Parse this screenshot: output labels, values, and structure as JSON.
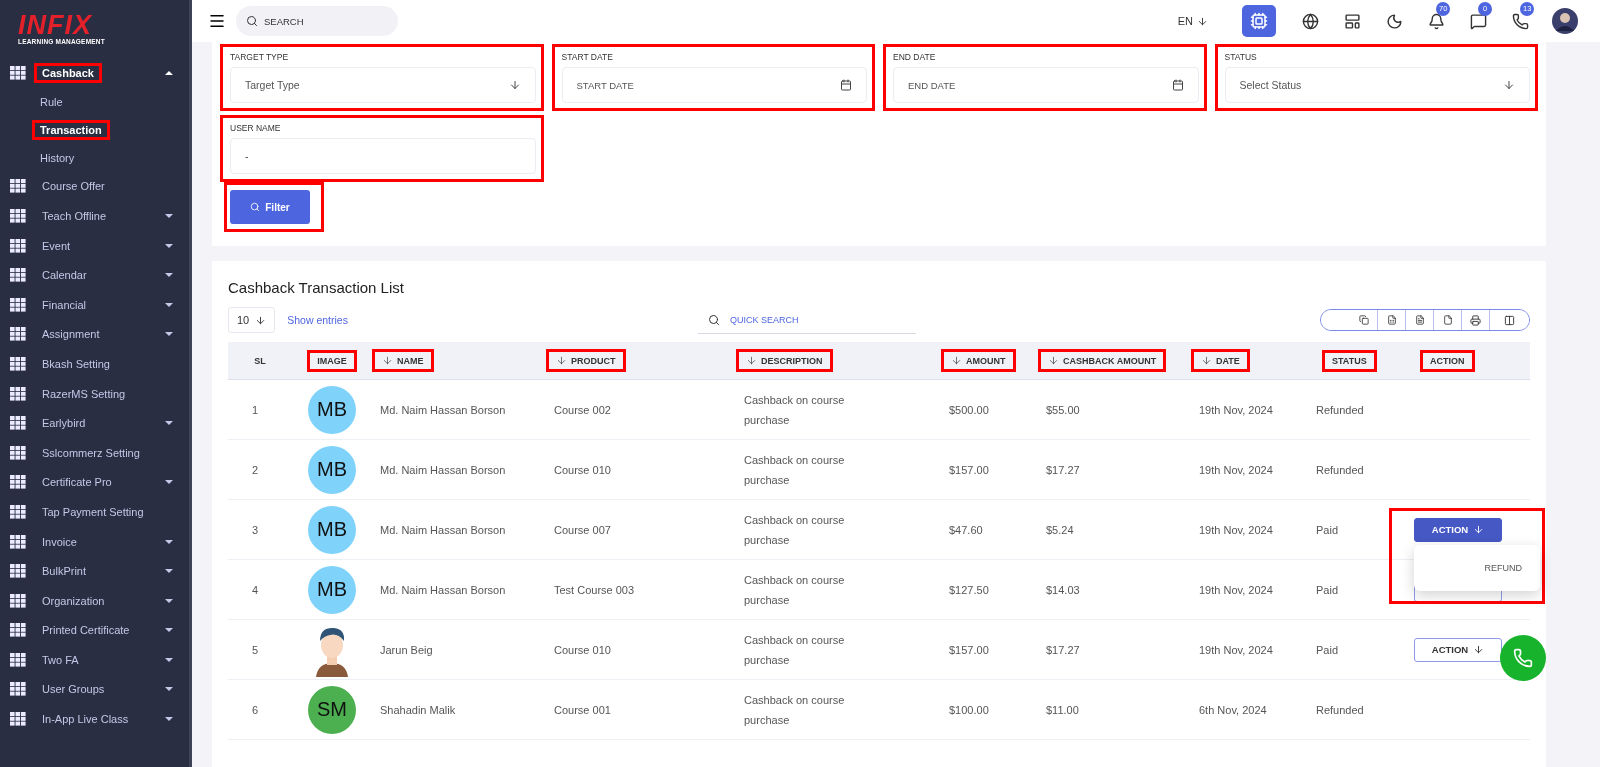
{
  "logo": {
    "brand": "INFIX",
    "tagline": "LEARNING MANAGEMENT"
  },
  "sidebar": {
    "items": [
      {
        "label": "Cashback",
        "has_menu": true,
        "expanded": true,
        "highlighted": true,
        "children": [
          {
            "label": "Rule",
            "selected": false,
            "highlighted": false
          },
          {
            "label": "Transaction",
            "selected": true,
            "highlighted": true
          },
          {
            "label": "History",
            "selected": false,
            "highlighted": false
          }
        ]
      },
      {
        "label": "Course Offer",
        "has_menu": false,
        "expanded": false,
        "highlighted": false
      },
      {
        "label": "Teach Offline",
        "has_menu": true,
        "expanded": false,
        "highlighted": false
      },
      {
        "label": "Event",
        "has_menu": true,
        "expanded": false,
        "highlighted": false
      },
      {
        "label": "Calendar",
        "has_menu": true,
        "expanded": false,
        "highlighted": false
      },
      {
        "label": "Financial",
        "has_menu": true,
        "expanded": false,
        "highlighted": false
      },
      {
        "label": "Assignment",
        "has_menu": true,
        "expanded": false,
        "highlighted": false
      },
      {
        "label": "Bkash Setting",
        "has_menu": false,
        "expanded": false,
        "highlighted": false
      },
      {
        "label": "RazerMS Setting",
        "has_menu": false,
        "expanded": false,
        "highlighted": false
      },
      {
        "label": "Earlybird",
        "has_menu": true,
        "expanded": false,
        "highlighted": false
      },
      {
        "label": "Sslcommerz Setting",
        "has_menu": false,
        "expanded": false,
        "highlighted": false
      },
      {
        "label": "Certificate Pro",
        "has_menu": true,
        "expanded": false,
        "highlighted": false
      },
      {
        "label": "Tap Payment Setting",
        "has_menu": false,
        "expanded": false,
        "highlighted": false
      },
      {
        "label": "Invoice",
        "has_menu": true,
        "expanded": false,
        "highlighted": false
      },
      {
        "label": "BulkPrint",
        "has_menu": true,
        "expanded": false,
        "highlighted": false
      },
      {
        "label": "Organization",
        "has_menu": true,
        "expanded": false,
        "highlighted": false
      },
      {
        "label": "Printed Certificate",
        "has_menu": true,
        "expanded": false,
        "highlighted": false
      },
      {
        "label": "Two FA",
        "has_menu": true,
        "expanded": false,
        "highlighted": false
      },
      {
        "label": "User Groups",
        "has_menu": true,
        "expanded": false,
        "highlighted": false
      },
      {
        "label": "In-App Live Class",
        "has_menu": true,
        "expanded": false,
        "highlighted": false
      }
    ]
  },
  "topbar": {
    "search_placeholder": "SEARCH",
    "language": "EN",
    "badges": [
      {
        "kind": "bell",
        "count": "70"
      },
      {
        "kind": "chat",
        "count": "0"
      },
      {
        "kind": "phone",
        "count": "13"
      }
    ]
  },
  "filters": {
    "fields": [
      {
        "label": "TARGET TYPE",
        "kind": "select",
        "placeholder": "Target Type",
        "highlighted": true
      },
      {
        "label": "START DATE",
        "kind": "date",
        "placeholder": "START DATE",
        "highlighted": true
      },
      {
        "label": "END DATE",
        "kind": "date",
        "placeholder": "END DATE",
        "highlighted": true
      },
      {
        "label": "STATUS",
        "kind": "select",
        "placeholder": "Select Status",
        "highlighted": true
      },
      {
        "label": "USER NAME",
        "kind": "text",
        "value": "-",
        "highlighted": true
      }
    ],
    "button": {
      "label": "Filter",
      "highlighted": true
    }
  },
  "list": {
    "title": "Cashback Transaction List",
    "page_size": "10",
    "show_entries": "Show entries",
    "quick_search_placeholder": "QUICK SEARCH",
    "columns": [
      {
        "label": "SL",
        "sortable": false,
        "highlighted": false
      },
      {
        "label": "IMAGE",
        "sortable": false,
        "highlighted": true
      },
      {
        "label": "NAME",
        "sortable": true,
        "highlighted": true
      },
      {
        "label": "PRODUCT",
        "sortable": true,
        "highlighted": true
      },
      {
        "label": "DESCRIPTION",
        "sortable": true,
        "highlighted": true
      },
      {
        "label": "AMOUNT",
        "sortable": true,
        "highlighted": true
      },
      {
        "label": "CASHBACK AMOUNT",
        "sortable": true,
        "highlighted": true
      },
      {
        "label": "DATE",
        "sortable": true,
        "highlighted": true
      },
      {
        "label": "STATUS",
        "sortable": false,
        "highlighted": true
      },
      {
        "label": "ACTION",
        "sortable": false,
        "highlighted": true
      }
    ],
    "rows": [
      {
        "sl": "1",
        "avatar": {
          "kind": "initials",
          "text": "MB",
          "color": "#7fd3fb"
        },
        "name": "Md. Naim Hassan Borson",
        "product": "Course 002",
        "description": "Cashback on course purchase",
        "amount": "$500.00",
        "cashback": "$55.00",
        "date": "19th Nov, 2024",
        "status": "Refunded"
      },
      {
        "sl": "2",
        "avatar": {
          "kind": "initials",
          "text": "MB",
          "color": "#7fd3fb"
        },
        "name": "Md. Naim Hassan Borson",
        "product": "Course 010",
        "description": "Cashback on course purchase",
        "amount": "$157.00",
        "cashback": "$17.27",
        "date": "19th Nov, 2024",
        "status": "Refunded"
      },
      {
        "sl": "3",
        "avatar": {
          "kind": "initials",
          "text": "MB",
          "color": "#7fd3fb"
        },
        "name": "Md. Naim Hassan Borson",
        "product": "Course 007",
        "description": "Cashback on course purchase",
        "amount": "$47.60",
        "cashback": "$5.24",
        "date": "19th Nov, 2024",
        "status": "Paid",
        "action": {
          "label": "ACTION",
          "open": true,
          "menu": [
            "REFUND"
          ],
          "highlighted": true
        }
      },
      {
        "sl": "4",
        "avatar": {
          "kind": "initials",
          "text": "MB",
          "color": "#7fd3fb"
        },
        "name": "Md. Naim Hassan Borson",
        "product": "Test Course 003",
        "description": "Cashback on course purchase",
        "amount": "$127.50",
        "cashback": "$14.03",
        "date": "19th Nov, 2024",
        "status": "Paid",
        "action": {
          "open": false,
          "highlighted": false
        }
      },
      {
        "sl": "5",
        "avatar": {
          "kind": "figure"
        },
        "name": "Jarun Beig",
        "product": "Course 010",
        "description": "Cashback on course purchase",
        "amount": "$157.00",
        "cashback": "$17.27",
        "date": "19th Nov, 2024",
        "status": "Paid",
        "action": {
          "label": "ACTION",
          "open": false,
          "highlighted": false
        }
      },
      {
        "sl": "6",
        "avatar": {
          "kind": "initials",
          "text": "SM",
          "color": "#4caf50"
        },
        "name": "Shahadin Malik",
        "product": "Course 001",
        "description": "Cashback on course purchase",
        "amount": "$100.00",
        "cashback": "$11.00",
        "date": "6th Nov, 2024",
        "status": "Refunded"
      }
    ]
  }
}
